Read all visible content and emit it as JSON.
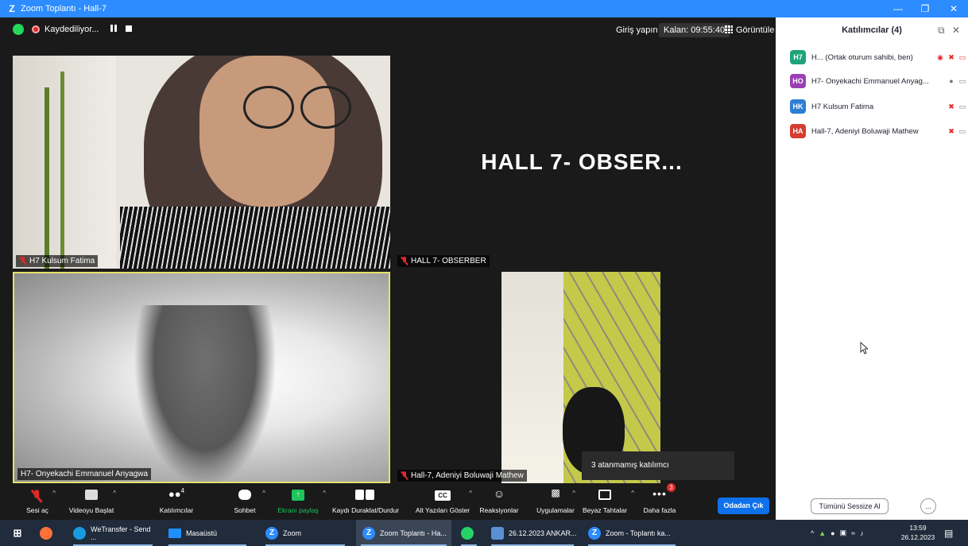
{
  "window": {
    "title": "Zoom Toplantı - Hall-7",
    "logo": "Z"
  },
  "topbar": {
    "recording_label": "Kaydediliyor...",
    "signin_label": "Giriş yapın",
    "timer_label": "Kalan: 09:55:40",
    "view_label": "Görüntüle"
  },
  "tiles": [
    {
      "name": "H7 Kulsum Fatima",
      "muted": true
    },
    {
      "name": "HALL 7- OBSERBER",
      "big_label": "HALL 7- OBSER...",
      "muted": true
    },
    {
      "name": "H7- Onyekachi Emmanuel Anyagwa",
      "muted": false,
      "active_speaker": true
    },
    {
      "name": "Hall-7, Adeniyi Boluwaji Mathew",
      "muted": true
    }
  ],
  "tooltip": "3 atanmamış katılımcı",
  "toolbar": {
    "unmute": "Sesi aç",
    "start_video": "Videoyu Başlat",
    "participants": "Katılımcılar",
    "participants_count": "4",
    "chat": "Sohbet",
    "share_screen": "Ekranı paylaş",
    "recording": "Kaydı Duraklat/Durdur",
    "captions": "Alt Yazıları Göster",
    "captions_icon": "CC",
    "reactions": "Reaksiyonlar",
    "apps": "Uygulamalar",
    "whiteboard": "Beyaz Tahtalar",
    "more": "Daha fazla",
    "more_badge": "3",
    "leave": "Odadan Çık"
  },
  "panel": {
    "title": "Katılımcılar (4)",
    "participants": [
      {
        "initials": "H7",
        "name": "H... (Ortak oturum sahibi, ben)",
        "color": "#1fa37a"
      },
      {
        "initials": "HO",
        "name": "H7- Onyekachi Emmanuel Anyag...",
        "color": "#9b3fb5"
      },
      {
        "initials": "HK",
        "name": "H7 Kulsum Fatima",
        "color": "#2d7dd2"
      },
      {
        "initials": "HA",
        "name": "Hall-7, Adeniyi Boluwaji Mathew",
        "color": "#d43d2f"
      }
    ],
    "mute_all": "Tümünü Sessize Al",
    "more": "..."
  },
  "taskbar": {
    "items": [
      {
        "label": "WeTransfer - Send ..."
      },
      {
        "label": "Masaüstü"
      },
      {
        "label": "Zoom"
      },
      {
        "label": "Zoom Toplantı - Ha..."
      },
      {
        "label": "26.12.2023 ANKAR..."
      },
      {
        "label": "Zoom - Toplantı ka..."
      }
    ],
    "time": "13:59",
    "date": "26.12.2023"
  },
  "colors": {
    "accent": "#2d8cff",
    "leave_button": "#0e71eb",
    "muted_red": "#e02828",
    "share_green": "#1ec45c",
    "active_border": "#e3e36b"
  }
}
